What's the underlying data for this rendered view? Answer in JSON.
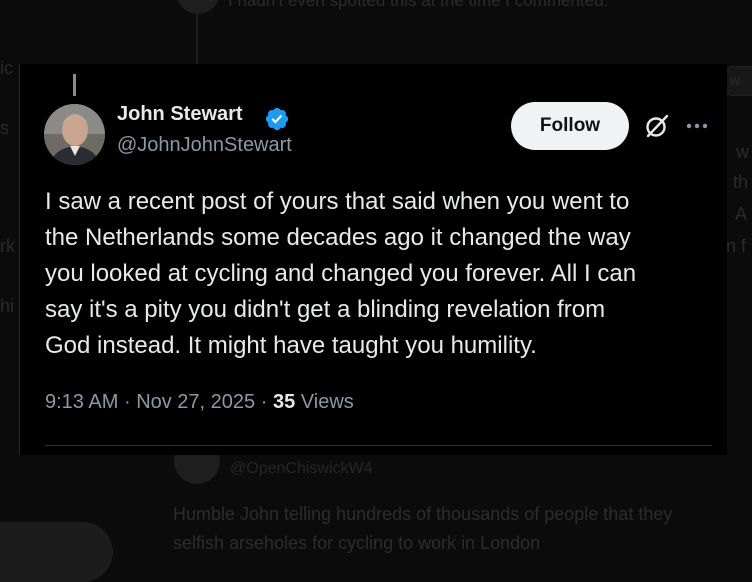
{
  "background": {
    "top_comment": "I hadn't even spotted this at the time I commented.",
    "reply_handle": "@OpenChiswickW4",
    "reply_lines": [
      "Humble John telling hundreds of thousands of people that they",
      "selfish arseholes for cycling to work in London"
    ],
    "left_fragments": [
      "ic",
      "s",
      "rk",
      "hi"
    ],
    "right_fragments": [
      "w",
      "w",
      "th",
      "A",
      "n f"
    ]
  },
  "tweet": {
    "author_name": "John Stewart",
    "author_handle": "@JohnJohnStewart",
    "verified": true,
    "follow_label": "Follow",
    "body": "I saw a recent post of yours that said when you went to\nthe Netherlands some decades ago it changed the way\nyou looked at cycling and changed you forever. All I can\nsay it's a pity you didn't get a blinding revelation from\nGod instead. It might have taught you humility.",
    "time": "9:13 AM",
    "separator": "·",
    "date": "Nov 27, 2025",
    "views_count": "35",
    "views_label": "Views"
  },
  "colors": {
    "card_bg": "#000000",
    "text_primary": "#e7e9ea",
    "text_secondary": "#8b98a5",
    "verified_badge": "#1d9bf0",
    "follow_bg": "#eff3f4"
  },
  "icons": {
    "verified": "verified-badge-icon",
    "grok": "grok-icon",
    "more": "more-options-icon"
  }
}
